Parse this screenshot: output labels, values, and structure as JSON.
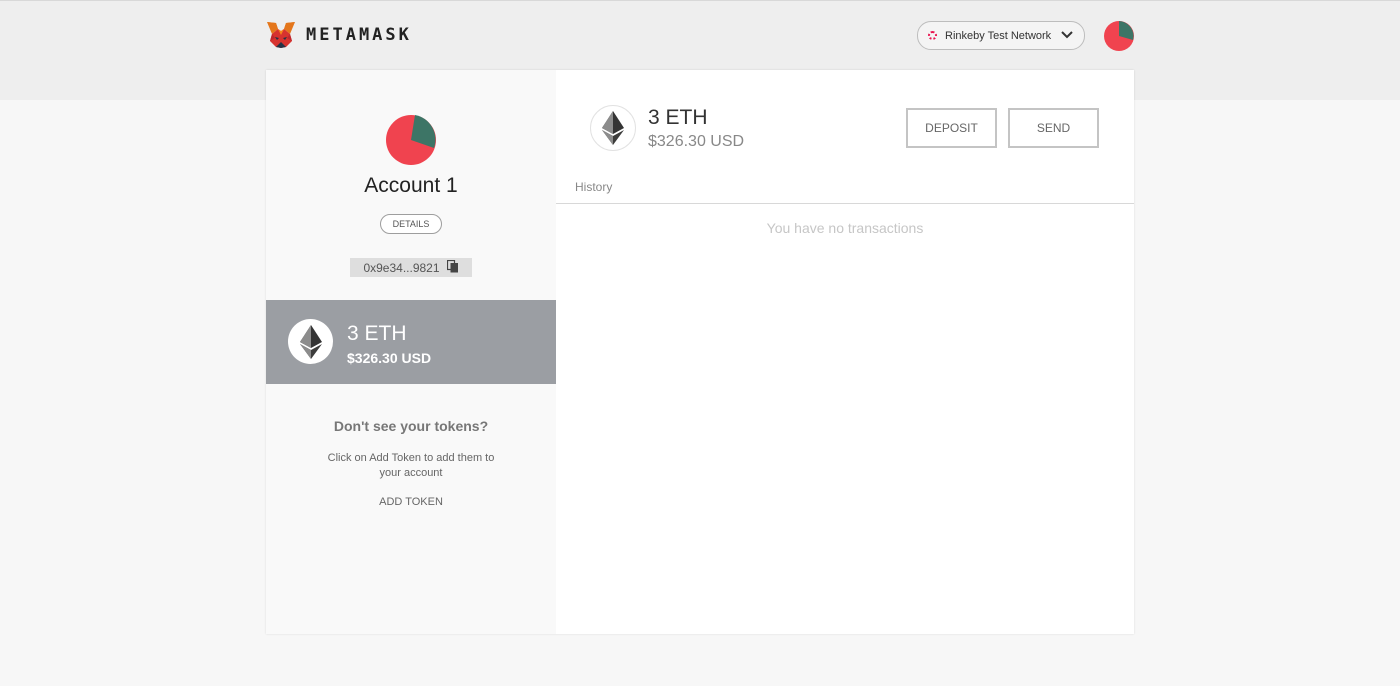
{
  "header": {
    "app_name": "METAMASK",
    "logo_icon": "metamask-fox-icon",
    "network": {
      "label": "Rinkeby Test Network",
      "dot_color": "#e91550",
      "chevron_icon": "chevron-down-icon"
    },
    "avatar_icon": "identicon-avatar"
  },
  "sidebar": {
    "account_name": "Account 1",
    "details_label": "DETAILS",
    "address": "0x9e34...9821",
    "copy_icon": "copy-icon",
    "token": {
      "icon": "ethereum-icon",
      "amount": "3 ETH",
      "usd": "$326.30 USD"
    },
    "no_tokens_title": "Don't see your tokens?",
    "no_tokens_text": "Click on Add Token to add them to your account",
    "add_token_label": "ADD TOKEN"
  },
  "main": {
    "balance_icon": "ethereum-icon",
    "balance_amount": "3 ETH",
    "balance_usd": "$326.30 USD",
    "deposit_label": "DEPOSIT",
    "send_label": "SEND",
    "history_label": "History",
    "empty_text": "You have no transactions"
  },
  "colors": {
    "identicon_red": "#f0434f",
    "identicon_teal": "#3d7566",
    "token_row_bg": "#9b9ea3",
    "accent_network": "#e91550"
  }
}
